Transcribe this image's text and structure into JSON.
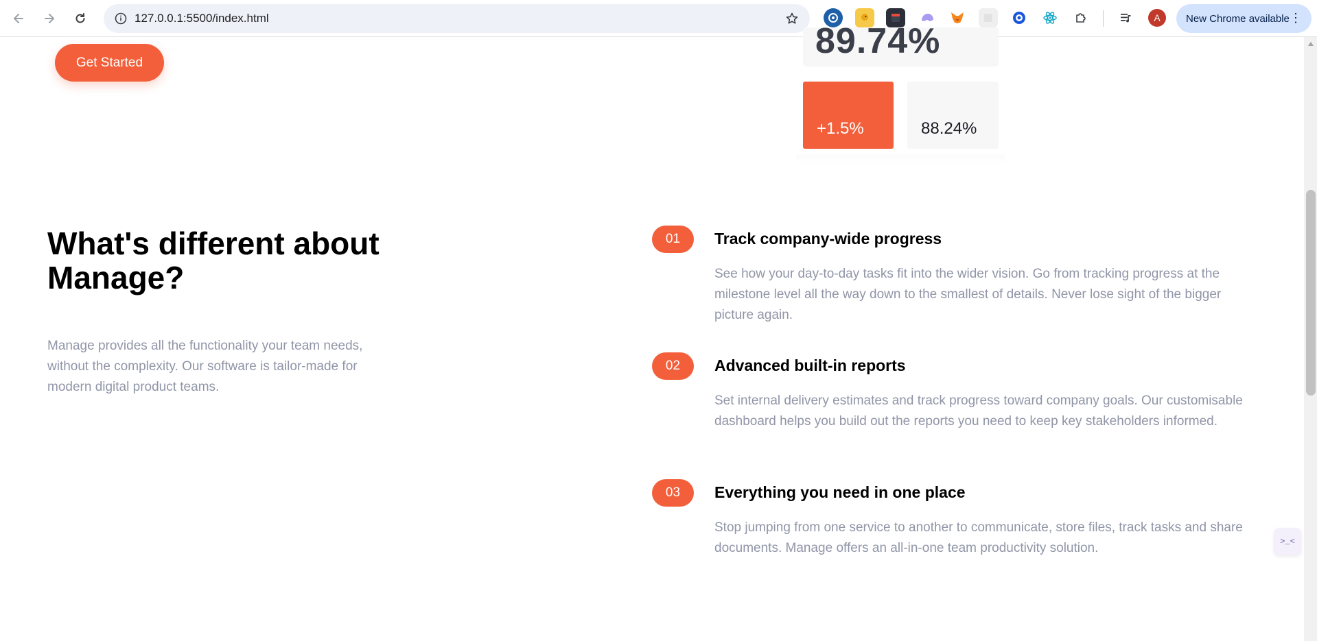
{
  "browser": {
    "url": "127.0.0.1:5500/index.html",
    "update_label": "New Chrome available",
    "profile_initial": "A",
    "extensions": [
      "radar-icon",
      "duck-icon",
      "dark-app-icon",
      "ghost-icon",
      "fox-icon",
      "blank-ext-icon",
      "circle-target-icon",
      "atom-icon"
    ]
  },
  "hero": {
    "cta_label": "Get Started",
    "stat_main": "89.74%",
    "stat_change": "+1.5%",
    "stat_secondary": "88.24%"
  },
  "about": {
    "title": "What's different about Manage?",
    "description": "Manage provides all the functionality your team needs, without the complexity. Our software is tailor-made for modern digital product teams."
  },
  "features": [
    {
      "number": "01",
      "title": "Track company-wide progress",
      "text": "See how your day-to-day tasks fit into the wider vision. Go from tracking progress at the milestone level all the way down to the smallest of details. Never lose sight of the bigger picture again."
    },
    {
      "number": "02",
      "title": "Advanced built-in reports",
      "text": "Set internal delivery estimates and track progress toward company goals. Our customisable dashboard helps you build out the reports you need to keep key stakeholders informed."
    },
    {
      "number": "03",
      "title": "Everything you need in one place",
      "text": "Stop jumping from one service to another to communicate, store files, track tasks and share documents. Manage offers an all-in-one team productivity solution."
    }
  ],
  "widget_label": ">_<",
  "colors": {
    "accent": "#f25f3a",
    "muted_text": "#9095a7",
    "omnibox_bg": "#eef1f8",
    "update_pill_bg": "#d3e3fd"
  }
}
